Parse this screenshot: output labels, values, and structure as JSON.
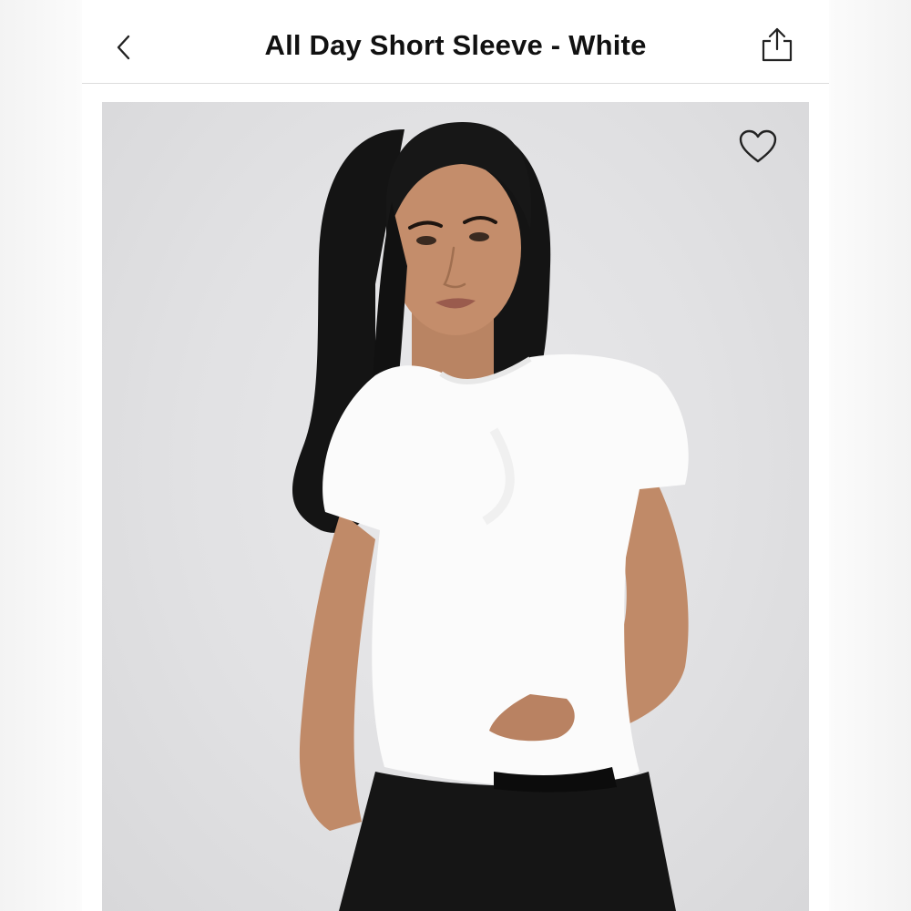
{
  "header": {
    "title": "All Day Short Sleeve - White",
    "back_icon": "chevron-left-icon",
    "share_icon": "share-icon"
  },
  "product_image": {
    "favorite_icon": "heart-outline-icon",
    "background_color": "#e2e2e4"
  },
  "colors": {
    "title_text": "#111111",
    "divider": "#dcdcdc",
    "icon_stroke": "#222222"
  }
}
